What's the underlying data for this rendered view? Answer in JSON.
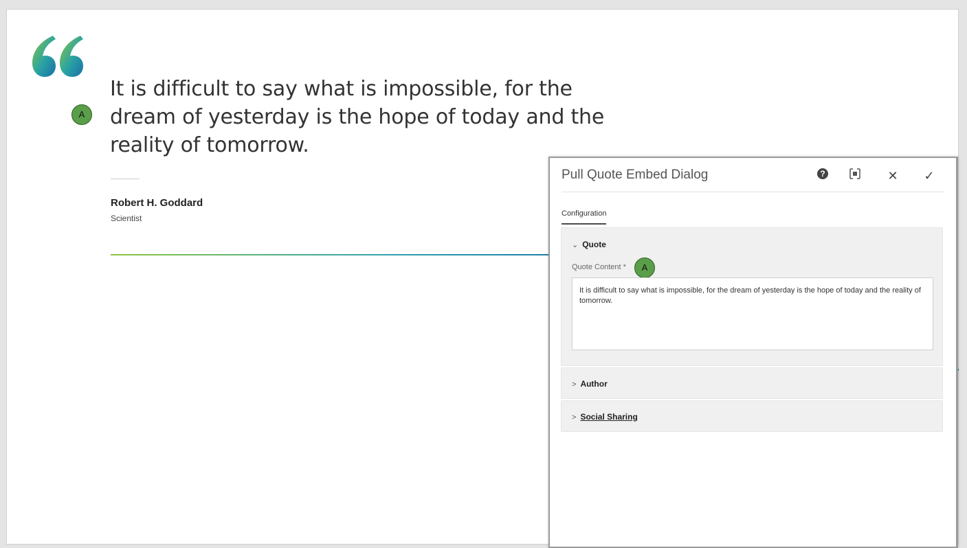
{
  "quote": {
    "text": "It is difficult to say what is impossible, for the dream of yesterday is the hope of today and the reality of tomorrow.",
    "author_name": "Robert H. Goddard",
    "author_role": "Scientist"
  },
  "callouts": {
    "quote_text": "A",
    "quote_content": "A"
  },
  "dialog": {
    "title": "Pull Quote Embed Dialog",
    "help_icon": "help-icon",
    "fullscreen_icon": "fullscreen-icon",
    "close_icon": "close-icon",
    "done_icon": "check-icon",
    "tabs": [
      {
        "label": "Configuration"
      }
    ],
    "sections": {
      "quote": {
        "label": "Quote",
        "expanded": true
      },
      "author": {
        "label": "Author",
        "expanded": false
      },
      "social": {
        "label": "Social Sharing",
        "expanded": false
      }
    },
    "quote_content": {
      "label": "Quote Content *",
      "value": "It is difficult to say what is impossible, for the dream of yesterday is the hope of today and the reality of tomorrow."
    }
  },
  "colors": {
    "accent_green": "#8cc63f",
    "accent_teal": "#1b7ca8",
    "callout_green": "#5a9e4a"
  }
}
